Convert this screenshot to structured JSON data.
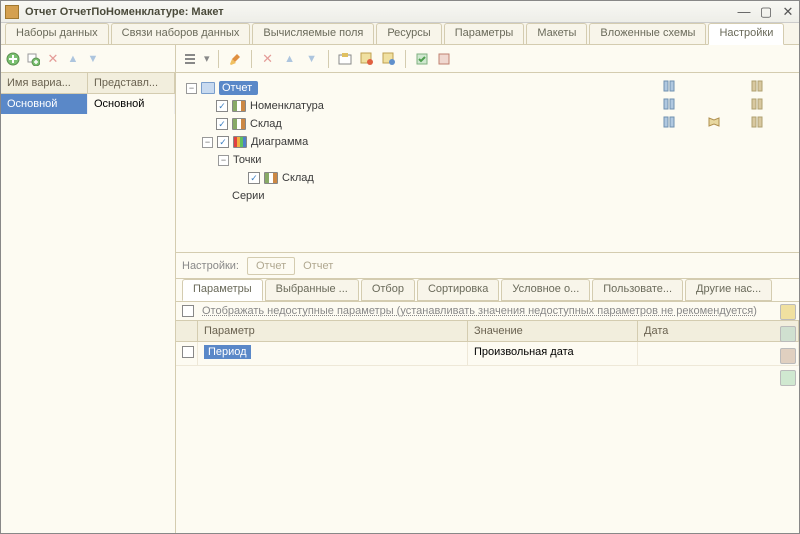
{
  "window": {
    "title": "Отчет ОтчетПоНоменклатуре: Макет"
  },
  "main_tabs": [
    "Наборы данных",
    "Связи наборов данных",
    "Вычисляемые поля",
    "Ресурсы",
    "Параметры",
    "Макеты",
    "Вложенные схемы",
    "Настройки"
  ],
  "main_tabs_active": 7,
  "variants": {
    "headers": [
      "Имя вариа...",
      "Представл..."
    ],
    "row": {
      "name": "Основной",
      "repr": "Основной"
    }
  },
  "tree": {
    "report": "Отчет",
    "nomen": "Номенклатура",
    "sklad1": "Склад",
    "diagram": "Диаграмма",
    "points": "Точки",
    "sklad2": "Склад",
    "series": "Серии"
  },
  "settings": {
    "label": "Настройки:",
    "box": "Отчет",
    "text": "Отчет"
  },
  "sub_tabs": [
    "Параметры",
    "Выбранные ...",
    "Отбор",
    "Сортировка",
    "Условное о...",
    "Пользовате...",
    "Другие нас..."
  ],
  "sub_tabs_active": 0,
  "params": {
    "checkbox_label": "Отображать недоступные параметры (устанавливать значения недоступных параметров не рекомендуется)",
    "headers": {
      "param": "Параметр",
      "value": "Значение",
      "date": "Дата"
    },
    "row": {
      "param": "Период",
      "value": "Произвольная дата",
      "date": ""
    }
  }
}
